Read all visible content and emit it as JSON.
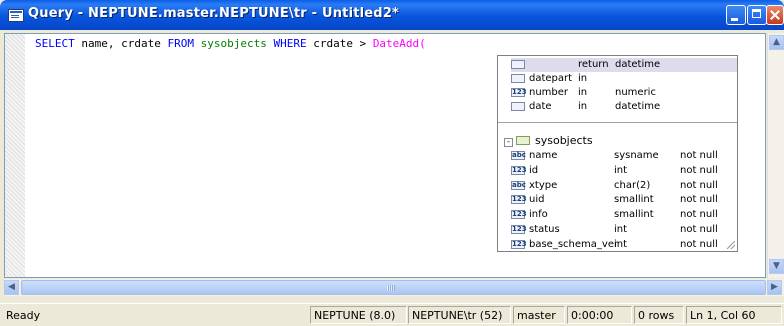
{
  "window": {
    "title": "Query - NEPTUNE.master.NEPTUNE\\tr - Untitled2*"
  },
  "editor": {
    "code_tokens": {
      "select": "SELECT",
      "columns": " name, crdate ",
      "from": "FROM",
      "table": " sysobjects ",
      "where": "WHERE",
      "cond": " crdate > ",
      "func": "DateAdd("
    }
  },
  "popup": {
    "signature": {
      "header": {
        "mode": "return",
        "type": "datetime"
      },
      "params": [
        {
          "icon": "calendar-icon",
          "name": "datepart",
          "mode": "in",
          "type": ""
        },
        {
          "icon": "numeric-icon",
          "icon_text": "123",
          "name": "number",
          "mode": "in",
          "type": "numeric"
        },
        {
          "icon": "calendar-icon",
          "name": "date",
          "mode": "in",
          "type": "datetime"
        }
      ]
    },
    "table": {
      "name": "sysobjects",
      "expander": "-",
      "columns": [
        {
          "icon_text": "abc",
          "name": "name",
          "type": "sysname",
          "nullability": "not null"
        },
        {
          "icon_text": "123",
          "name": "id",
          "type": "int",
          "nullability": "not null"
        },
        {
          "icon_text": "abc",
          "name": "xtype",
          "type": "char(2)",
          "nullability": "not null"
        },
        {
          "icon_text": "123",
          "name": "uid",
          "type": "smallint",
          "nullability": "not null"
        },
        {
          "icon_text": "123",
          "name": "info",
          "type": "smallint",
          "nullability": "not null"
        },
        {
          "icon_text": "123",
          "name": "status",
          "type": "int",
          "nullability": "not null"
        },
        {
          "icon_text": "123",
          "name": "base_schema_ver",
          "type": "int",
          "nullability": "not null"
        }
      ]
    }
  },
  "statusbar": {
    "state": "Ready",
    "server": "NEPTUNE (8.0)",
    "user": "NEPTUNE\\tr (52)",
    "database": "master",
    "elapsed": "0:00:00",
    "rows": "0 rows",
    "position": "Ln 1, Col 60"
  }
}
